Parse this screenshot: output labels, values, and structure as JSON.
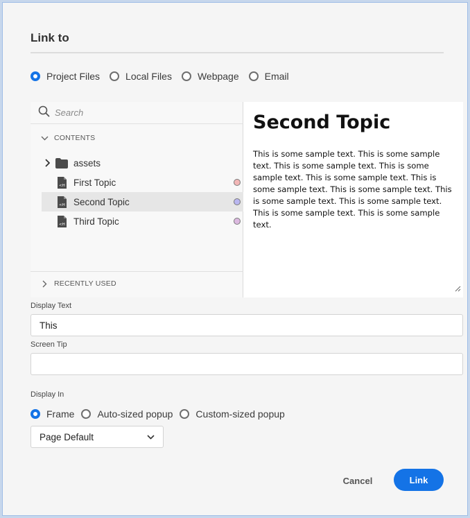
{
  "dialog": {
    "title": "Link to"
  },
  "link_types": [
    {
      "label": "Project Files",
      "checked": true
    },
    {
      "label": "Local Files",
      "checked": false
    },
    {
      "label": "Webpage",
      "checked": false
    },
    {
      "label": "Email",
      "checked": false
    }
  ],
  "browser": {
    "search_placeholder": "Search",
    "contents_label": "CONTENTS",
    "recently_used_label": "RECENTLY USED",
    "items": [
      {
        "label": "assets",
        "icon": "folder-icon"
      },
      {
        "label": "First Topic",
        "icon": "topic-file-icon",
        "status_color": "#f2b6b6"
      },
      {
        "label": "Second Topic",
        "icon": "topic-file-icon",
        "status_color": "#b9b6f0",
        "selected": true
      },
      {
        "label": "Third Topic",
        "icon": "topic-file-icon",
        "status_color": "#dcb9e0"
      }
    ]
  },
  "preview": {
    "title": "Second Topic",
    "body": "This is some sample text. This is some sample text. This is some sample text. This is some sample text. This is some sample text. This is some sample text. This is some sample text. This is some sample text. This is some sample text. This is some sample text. This is some sample text."
  },
  "display_text": {
    "label": "Display Text",
    "value": "This"
  },
  "screen_tip": {
    "label": "Screen Tip",
    "value": ""
  },
  "display_in": {
    "label": "Display In",
    "options": [
      {
        "label": "Frame",
        "checked": true
      },
      {
        "label": "Auto-sized popup",
        "checked": false
      },
      {
        "label": "Custom-sized popup",
        "checked": false
      }
    ],
    "select_value": "Page Default"
  },
  "buttons": {
    "cancel": "Cancel",
    "link": "Link"
  },
  "colors": {
    "accent": "#1473e6"
  }
}
